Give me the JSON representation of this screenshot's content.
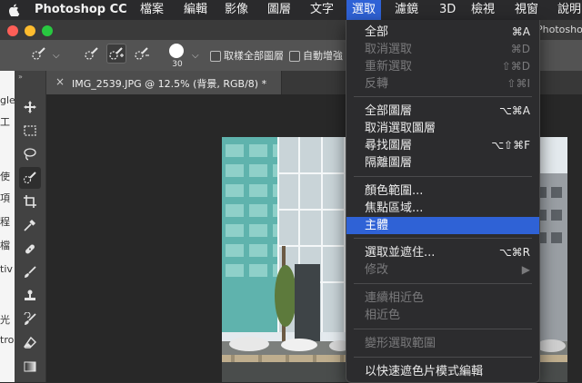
{
  "menubar": {
    "apple_icon": "apple-logo-icon",
    "app_name": "Photoshop CC",
    "items": [
      "檔案",
      "編輯",
      "影像",
      "圖層",
      "文字",
      "選取",
      "濾鏡",
      "3D",
      "檢視",
      "視窗",
      "說明"
    ],
    "active_item": "選取"
  },
  "window": {
    "title": "Photoshop"
  },
  "options_bar": {
    "brush_size": "30",
    "sample_all_layers": "取樣全部圖層",
    "auto_enhance": "自動增強"
  },
  "left_sliver": {
    "lines": [
      "gle",
      "工",
      "使",
      "項",
      "程",
      "檔",
      "tiv",
      "光",
      "tro"
    ]
  },
  "document": {
    "close": "×",
    "tab_title": "IMG_2539.JPG @ 12.5% (背景, RGB/8) *"
  },
  "tools": [
    "move-icon",
    "marquee-icon",
    "lasso-icon",
    "quick-selection-icon",
    "crop-icon",
    "eyedropper-icon",
    "healing-brush-icon",
    "brush-icon",
    "clone-stamp-icon",
    "history-brush-icon",
    "eraser-icon",
    "gradient-icon"
  ],
  "select_menu": {
    "groups": [
      [
        {
          "label": "全部",
          "shortcut": "⌘A",
          "disabled": false
        },
        {
          "label": "取消選取",
          "shortcut": "⌘D",
          "disabled": true
        },
        {
          "label": "重新選取",
          "shortcut": "⇧⌘D",
          "disabled": true
        },
        {
          "label": "反轉",
          "shortcut": "⇧⌘I",
          "disabled": true
        }
      ],
      [
        {
          "label": "全部圖層",
          "shortcut": "⌥⌘A",
          "disabled": false
        },
        {
          "label": "取消選取圖層",
          "shortcut": "",
          "disabled": false
        },
        {
          "label": "尋找圖層",
          "shortcut": "⌥⇧⌘F",
          "disabled": false
        },
        {
          "label": "隔離圖層",
          "shortcut": "",
          "disabled": false
        }
      ],
      [
        {
          "label": "顏色範圍...",
          "shortcut": "",
          "disabled": false
        },
        {
          "label": "焦點區域...",
          "shortcut": "",
          "disabled": false
        },
        {
          "label": "主體",
          "shortcut": "",
          "disabled": false,
          "highlight": true
        }
      ],
      [
        {
          "label": "選取並遮住...",
          "shortcut": "⌥⌘R",
          "disabled": false
        },
        {
          "label": "修改",
          "shortcut": "▶",
          "disabled": true
        }
      ],
      [
        {
          "label": "連續相近色",
          "shortcut": "",
          "disabled": true
        },
        {
          "label": "相近色",
          "shortcut": "",
          "disabled": true
        }
      ],
      [
        {
          "label": "變形選取範圍",
          "shortcut": "",
          "disabled": true
        }
      ],
      [
        {
          "label": "以快速遮色片模式編輯",
          "shortcut": "",
          "disabled": false
        }
      ]
    ]
  },
  "colors": {
    "menu_highlight": "#2f62d6",
    "traffic_close": "#fe5f57",
    "traffic_minimize": "#febc2e",
    "traffic_zoom": "#28c840"
  }
}
